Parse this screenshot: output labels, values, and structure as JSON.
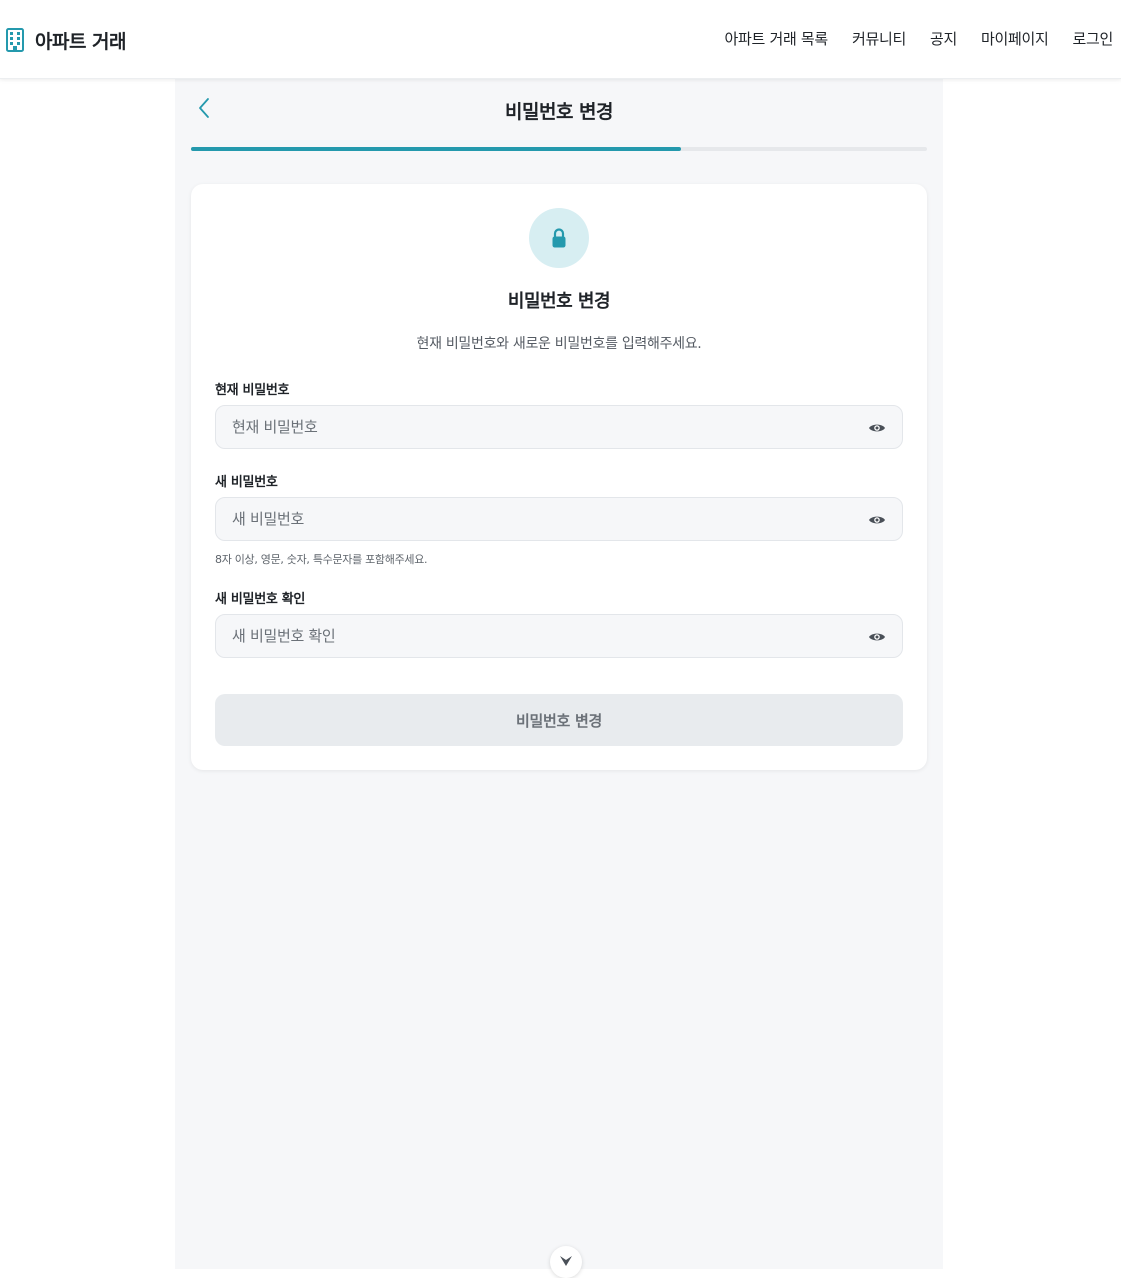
{
  "app": {
    "brand_name": "아파트 거래",
    "nav_items": [
      "아파트 거래 목록",
      "커뮤니티",
      "공지",
      "마이페이지",
      "로그인"
    ]
  },
  "page": {
    "title": "비밀번호 변경",
    "progress_fraction": 0.666
  },
  "card": {
    "icon": "lock-icon",
    "title": "비밀번호 변경",
    "description": "현재 비밀번호와 새로운 비밀번호를 입력해주세요.",
    "fields": [
      {
        "label": "현재 비밀번호",
        "placeholder": "현재 비밀번호",
        "value": ""
      },
      {
        "label": "새 비밀번호",
        "placeholder": "새 비밀번호",
        "value": "",
        "hint": "8자 이상, 영문, 숫자, 특수문자를 포함해주세요."
      },
      {
        "label": "새 비밀번호 확인",
        "placeholder": "새 비밀번호 확인",
        "value": ""
      }
    ],
    "submit_label": "비밀번호 변경"
  },
  "colors": {
    "accent": "#2499ad",
    "lock_bg": "#d7eef2",
    "page_bg": "#f6f7f9",
    "button_disabled_bg": "#e8ebee"
  }
}
